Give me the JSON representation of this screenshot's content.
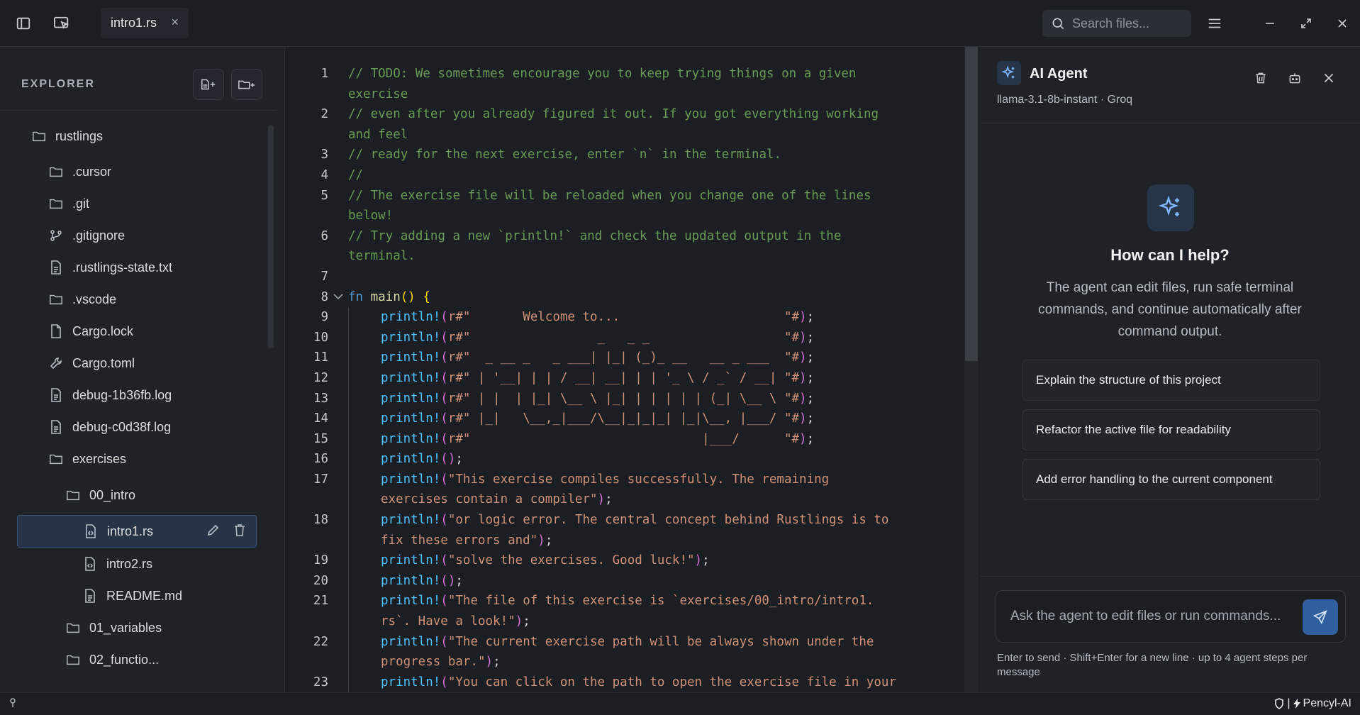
{
  "tab": {
    "label": "intro1.rs",
    "close": "×"
  },
  "search": {
    "placeholder": "Search files..."
  },
  "explorer": {
    "title": "EXPLORER",
    "items": [
      {
        "label": "rustlings",
        "icon": "folder-icon"
      },
      {
        "label": ".cursor",
        "icon": "folder-icon"
      },
      {
        "label": ".git",
        "icon": "folder-icon"
      },
      {
        "label": ".gitignore",
        "icon": "git-branch-icon"
      },
      {
        "label": ".rustlings-state.txt",
        "icon": "file-text-icon"
      },
      {
        "label": ".vscode",
        "icon": "folder-icon"
      },
      {
        "label": "Cargo.lock",
        "icon": "file-icon"
      },
      {
        "label": "Cargo.toml",
        "icon": "wrench-icon"
      },
      {
        "label": "debug-1b36fb.log",
        "icon": "file-text-icon"
      },
      {
        "label": "debug-c0d38f.log",
        "icon": "file-text-icon"
      },
      {
        "label": "exercises",
        "icon": "folder-icon"
      },
      {
        "label": "00_intro",
        "icon": "folder-icon"
      },
      {
        "label": "intro1.rs",
        "icon": "file-code-icon"
      },
      {
        "label": "intro2.rs",
        "icon": "file-code-icon"
      },
      {
        "label": "README.md",
        "icon": "file-text-icon"
      },
      {
        "label": "01_variables",
        "icon": "folder-icon"
      },
      {
        "label": "02_functio...",
        "icon": "folder-icon"
      }
    ]
  },
  "editor": {
    "line_numbers": [
      "1",
      "2",
      "3",
      "4",
      "5",
      "6",
      "7",
      "8",
      "9",
      "10",
      "11",
      "12",
      "13",
      "14",
      "15",
      "16",
      "17",
      "18",
      "19",
      "20",
      "21",
      "22",
      "23"
    ]
  },
  "agent": {
    "title": "AI Agent",
    "model": "llama-3.1-8b-instant · Groq",
    "help_title": "How can I help?",
    "help_desc": "The agent can edit files, run safe terminal commands, and continue automatically after command output.",
    "suggestions": [
      "Explain the structure of this project",
      "Refactor the active file for readability",
      "Add error handling to the current component"
    ],
    "composer_placeholder": "Ask the agent to edit files or run commands...",
    "hint": "Enter to send · Shift+Enter for a new line · up to 4 agent steps per message"
  },
  "status": {
    "brand": "Pencyl-AI",
    "separator": "|"
  }
}
